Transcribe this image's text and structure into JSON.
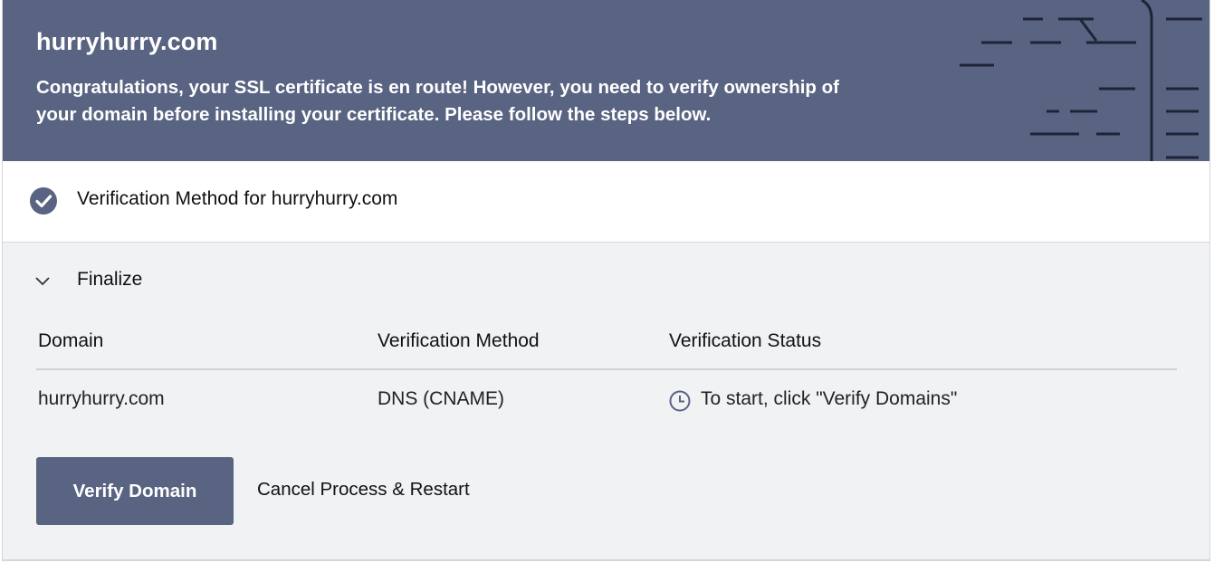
{
  "header": {
    "site": "hurryhurry.com",
    "message": "Congratulations, your SSL certificate is en route! However, you need to verify ownership of your domain before installing your certificate. Please follow the steps below.",
    "background_color": "#596382"
  },
  "verification_step": {
    "title": "Verification Method for hurryhurry.com",
    "status_icon": "check-circle-icon"
  },
  "finalize": {
    "title": "Finalize",
    "toggle_icon": "chevron-down-icon",
    "table": {
      "columns": [
        "Domain",
        "Verification Method",
        "Verification Status"
      ],
      "rows": [
        {
          "domain": "hurryhurry.com",
          "method": "DNS (CNAME)",
          "status": "To start, click \"Verify Domains\"",
          "status_icon": "clock-icon"
        }
      ]
    },
    "actions": {
      "verify": "Verify Domain",
      "cancel": "Cancel Process & Restart"
    }
  },
  "colors": {
    "accent": "#596382",
    "panel": "#f1f2f4"
  }
}
